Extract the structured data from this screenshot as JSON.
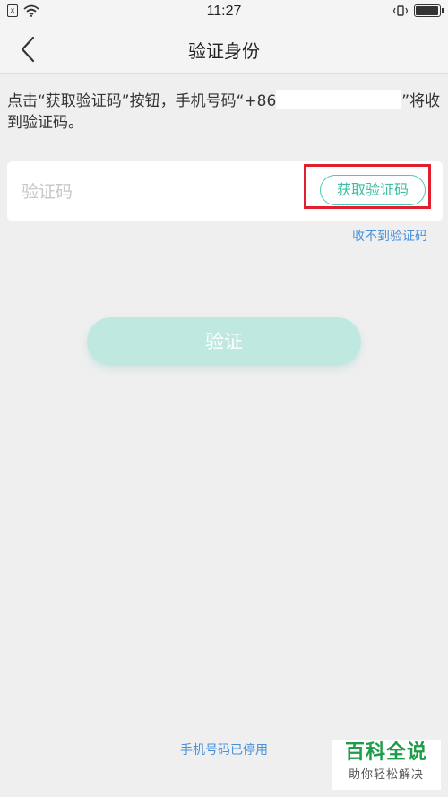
{
  "status_bar": {
    "sim_label": "x",
    "time": "11:27",
    "icons": [
      "sim-icon",
      "wifi-icon",
      "vibrate-icon",
      "battery-icon"
    ],
    "battery_level": 0.9
  },
  "nav": {
    "back_icon": "chevron-left-icon",
    "title": "验证身份"
  },
  "hint": {
    "prefix": "点击“获取验证码”按钮，手机号码“+86",
    "suffix": "”将收到验证码。"
  },
  "code_field": {
    "placeholder": "验证码",
    "value": ""
  },
  "get_code_label": "获取验证码",
  "no_code_link": "收不到验证码",
  "verify_label": "验证",
  "phone_disabled_link": "手机号码已停用",
  "watermark": {
    "title": "百科全说",
    "subtitle": "助你轻松解决"
  },
  "colors": {
    "accent": "#3cbfa6",
    "verify_button": "#bfe9e0",
    "link": "#4a90d9",
    "highlight": "#e0202e"
  }
}
